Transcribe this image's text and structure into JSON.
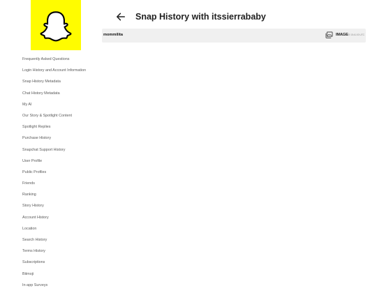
{
  "sidebar": {
    "items": [
      {
        "label": "Frequently Asked Questions"
      },
      {
        "label": "Login History and Account Information"
      },
      {
        "label": "Snap History Metadata"
      },
      {
        "label": "Chat History Metadata"
      },
      {
        "label": "My AI"
      },
      {
        "label": "Our Story & Spotlight Content"
      },
      {
        "label": "Spotlight Replies"
      },
      {
        "label": "Purchase History"
      },
      {
        "label": "Snapchat Support History"
      },
      {
        "label": "User Profile"
      },
      {
        "label": "Public Profiles"
      },
      {
        "label": "Friends"
      },
      {
        "label": "Ranking"
      },
      {
        "label": "Story History"
      },
      {
        "label": "Account History"
      },
      {
        "label": "Location"
      },
      {
        "label": "Search History"
      },
      {
        "label": "Terms History"
      },
      {
        "label": "Subscriptions"
      },
      {
        "label": "Bitmoji"
      },
      {
        "label": "In-app Surveys"
      }
    ]
  },
  "header": {
    "title": "Snap History with itssierrababy"
  },
  "snaps": [
    {
      "username": "mommilita",
      "media_type": "IMAGE",
      "timestamp": "2022-05-19 15:41:00 UTC"
    }
  ],
  "colors": {
    "brand_yellow": "#fffc00",
    "row_background": "#f0f0f0"
  },
  "icons": {
    "logo": "snapchat-ghost-icon",
    "back": "arrow-left-icon",
    "media": "photo-gallery-icon"
  }
}
